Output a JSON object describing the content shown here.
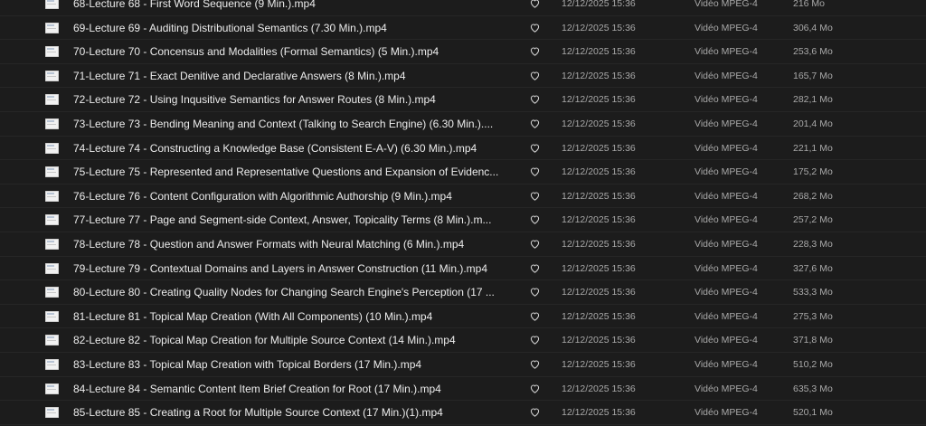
{
  "files": [
    {
      "name": "68-Lecture 68 - First Word Sequence (9 Min.).mp4",
      "date": "12/12/2025 15:36",
      "type": "Vidéo MPEG-4",
      "size": "216 Mo"
    },
    {
      "name": "69-Lecture 69 - Auditing Distributional Semantics (7.30 Min.).mp4",
      "date": "12/12/2025 15:36",
      "type": "Vidéo MPEG-4",
      "size": "306,4 Mo"
    },
    {
      "name": "70-Lecture 70 - Concensus and Modalities (Formal Semantics) (5 Min.).mp4",
      "date": "12/12/2025 15:36",
      "type": "Vidéo MPEG-4",
      "size": "253,6 Mo"
    },
    {
      "name": "71-Lecture 71 - Exact Denitive and Declarative Answers (8 Min.).mp4",
      "date": "12/12/2025 15:36",
      "type": "Vidéo MPEG-4",
      "size": "165,7 Mo"
    },
    {
      "name": "72-Lecture 72 - Using Inqusitive Semantics for Answer Routes (8 Min.).mp4",
      "date": "12/12/2025 15:36",
      "type": "Vidéo MPEG-4",
      "size": "282,1 Mo"
    },
    {
      "name": "73-Lecture 73 - Bending Meaning and Context (Talking to Search Engine) (6.30 Min.)....",
      "date": "12/12/2025 15:36",
      "type": "Vidéo MPEG-4",
      "size": "201,4 Mo"
    },
    {
      "name": "74-Lecture 74 - Constructing a Knowledge Base (Consistent E-A-V) (6.30 Min.).mp4",
      "date": "12/12/2025 15:36",
      "type": "Vidéo MPEG-4",
      "size": "221,1 Mo"
    },
    {
      "name": "75-Lecture 75 - Represented and Representative Questions and Expansion of Evidenc...",
      "date": "12/12/2025 15:36",
      "type": "Vidéo MPEG-4",
      "size": "175,2 Mo"
    },
    {
      "name": "76-Lecture 76 - Content Configuration with Algorithmic Authorship (9 Min.).mp4",
      "date": "12/12/2025 15:36",
      "type": "Vidéo MPEG-4",
      "size": "268,2 Mo"
    },
    {
      "name": "77-Lecture 77 - Page and Segment-side Context, Answer, Topicality Terms (8 Min.).m...",
      "date": "12/12/2025 15:36",
      "type": "Vidéo MPEG-4",
      "size": "257,2 Mo"
    },
    {
      "name": "78-Lecture 78 - Question and Answer Formats with Neural Matching (6 Min.).mp4",
      "date": "12/12/2025 15:36",
      "type": "Vidéo MPEG-4",
      "size": "228,3 Mo"
    },
    {
      "name": "79-Lecture 79 - Contextual Domains and Layers in Answer Construction (11 Min.).mp4",
      "date": "12/12/2025 15:36",
      "type": "Vidéo MPEG-4",
      "size": "327,6 Mo"
    },
    {
      "name": "80-Lecture 80 - Creating Quality Nodes for Changing Search Engine's Perception (17 ...",
      "date": "12/12/2025 15:36",
      "type": "Vidéo MPEG-4",
      "size": "533,3 Mo"
    },
    {
      "name": "81-Lecture 81 - Topical Map Creation (With All Components) (10 Min.).mp4",
      "date": "12/12/2025 15:36",
      "type": "Vidéo MPEG-4",
      "size": "275,3 Mo"
    },
    {
      "name": "82-Lecture 82 - Topical Map Creation for Multiple Source Context (14 Min.).mp4",
      "date": "12/12/2025 15:36",
      "type": "Vidéo MPEG-4",
      "size": "371,8 Mo"
    },
    {
      "name": "83-Lecture 83 - Topical Map Creation with Topical Borders (17 Min.).mp4",
      "date": "12/12/2025 15:36",
      "type": "Vidéo MPEG-4",
      "size": "510,2 Mo"
    },
    {
      "name": "84-Lecture 84 - Semantic Content Item Brief Creation for Root (17 Min.).mp4",
      "date": "12/12/2025 15:36",
      "type": "Vidéo MPEG-4",
      "size": "635,3 Mo"
    },
    {
      "name": "85-Lecture 85 - Creating a Root for Multiple Source Context (17 Min.)(1).mp4",
      "date": "12/12/2025 15:36",
      "type": "Vidéo MPEG-4",
      "size": "520,1 Mo"
    }
  ]
}
